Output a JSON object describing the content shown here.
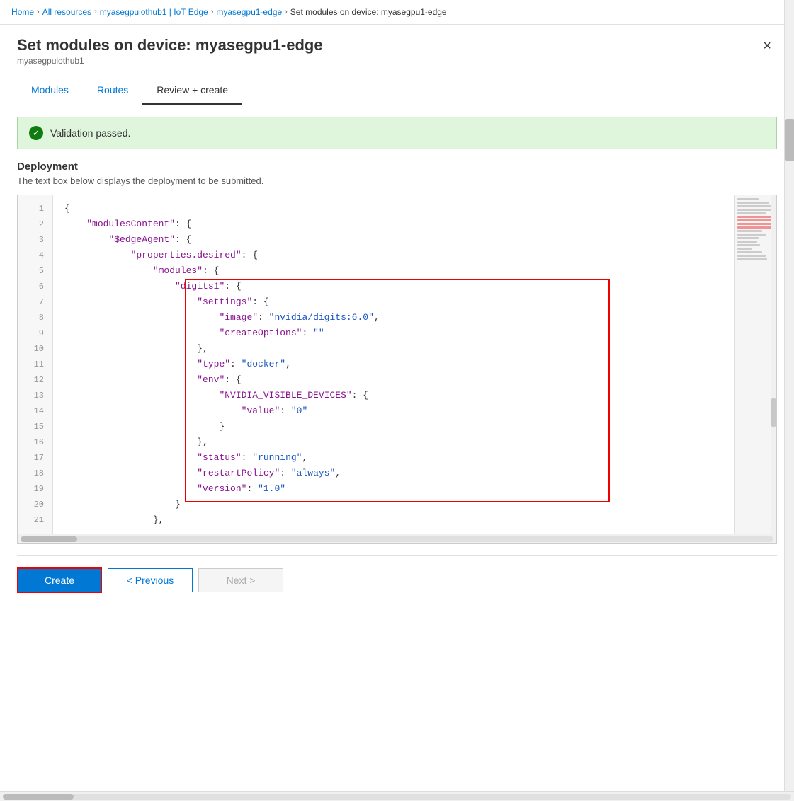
{
  "breadcrumb": {
    "home": "Home",
    "allResources": "All resources",
    "iothub": "myasegpuiothub1 | IoT Edge",
    "device": "myasegpu1-edge",
    "current": "Set modules on device: myasegpu1-edge"
  },
  "pageTitle": "Set modules on device: myasegpu1-edge",
  "pageSubtitle": "myasegpuiothub1",
  "closeButtonLabel": "×",
  "tabs": [
    {
      "id": "modules",
      "label": "Modules",
      "active": false
    },
    {
      "id": "routes",
      "label": "Routes",
      "active": false
    },
    {
      "id": "review-create",
      "label": "Review + create",
      "active": true
    }
  ],
  "validation": {
    "text": "Validation passed."
  },
  "deployment": {
    "title": "Deployment",
    "description": "The text box below displays the deployment to be submitted."
  },
  "codeLines": [
    {
      "num": 1,
      "content": "{"
    },
    {
      "num": 2,
      "content": "    \"modulesContent\": {"
    },
    {
      "num": 3,
      "content": "        \"$edgeAgent\": {"
    },
    {
      "num": 4,
      "content": "            \"properties.desired\": {"
    },
    {
      "num": 5,
      "content": "                \"modules\": {"
    },
    {
      "num": 6,
      "content": "                    \"digits1\": {"
    },
    {
      "num": 7,
      "content": "                        \"settings\": {"
    },
    {
      "num": 8,
      "content": "                            \"image\": \"nvidia/digits:6.0\","
    },
    {
      "num": 9,
      "content": "                            \"createOptions\": \"\""
    },
    {
      "num": 10,
      "content": "                        },"
    },
    {
      "num": 11,
      "content": "                        \"type\": \"docker\","
    },
    {
      "num": 12,
      "content": "                        \"env\": {"
    },
    {
      "num": 13,
      "content": "                            \"NVIDIA_VISIBLE_DEVICES\": {"
    },
    {
      "num": 14,
      "content": "                                \"value\": \"0\""
    },
    {
      "num": 15,
      "content": "                            }"
    },
    {
      "num": 16,
      "content": "                        },"
    },
    {
      "num": 17,
      "content": "                        \"status\": \"running\","
    },
    {
      "num": 18,
      "content": "                        \"restartPolicy\": \"always\","
    },
    {
      "num": 19,
      "content": "                        \"version\": \"1.0\""
    },
    {
      "num": 20,
      "content": "                    }"
    },
    {
      "num": 21,
      "content": "                },"
    }
  ],
  "buttons": {
    "create": "Create",
    "previous": "< Previous",
    "next": "Next >"
  },
  "colors": {
    "accent": "#0078d4",
    "validationGreen": "#dff6dd",
    "highlightRed": "#e00000"
  }
}
